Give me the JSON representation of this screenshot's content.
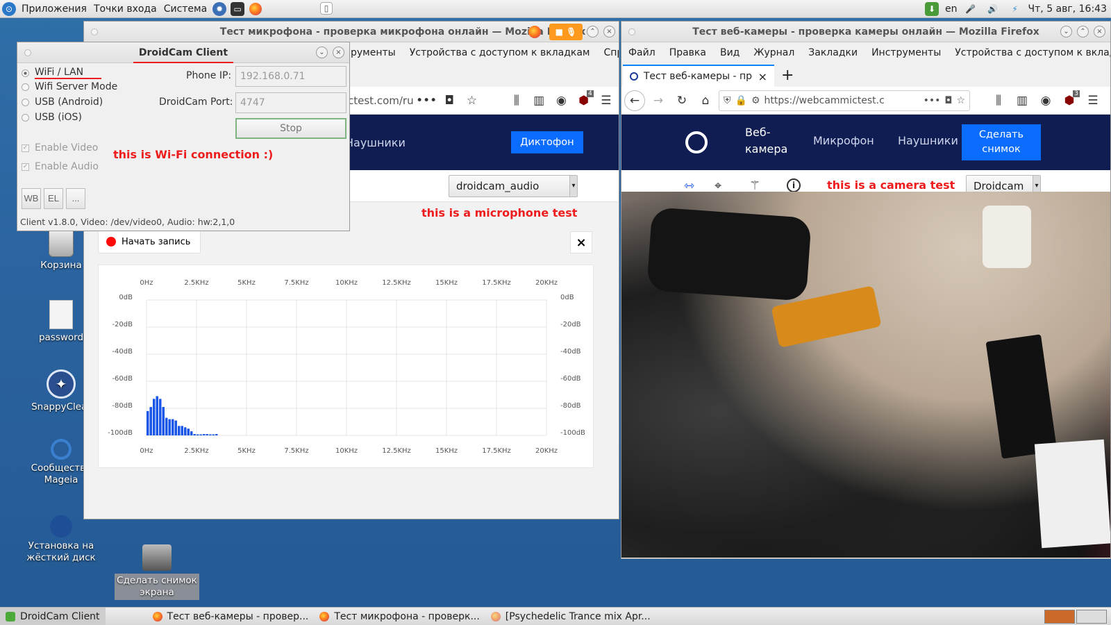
{
  "top_panel": {
    "menus": [
      "Приложения",
      "Точки входа",
      "Система"
    ],
    "lang": "en",
    "clock": "Чт, 5 авг, 16:43"
  },
  "desktop": {
    "icons": [
      {
        "label": "Корзина"
      },
      {
        "label": "password"
      },
      {
        "label": "SnappyClear"
      },
      {
        "label": "Сообщество Mageia"
      },
      {
        "label": "Установка на жёсткий диск"
      },
      {
        "label": "Сделать снимок экрана"
      }
    ]
  },
  "mic_window": {
    "title": "Тест микрофона - проверка микрофона онлайн — Mozilla Firefox",
    "menu_fragment": [
      "рументы",
      "Устройства с доступом к вкладкам",
      "Справ"
    ],
    "url_fragment": "ctest.com/ru/c",
    "nav_items": [
      "Наушники"
    ],
    "dictaphone_button": "Диктофон",
    "device_select": "droidcam_audio",
    "note": "this is a microphone test",
    "record_button": "Начать запись",
    "close_glyph": "×",
    "badge": "4"
  },
  "cam_window": {
    "title": "Тест веб-камеры - проверка камеры онлайн — Mozilla Firefox",
    "menu": [
      "Файл",
      "Правка",
      "Вид",
      "Журнал",
      "Закладки",
      "Инструменты",
      "Устройства с доступом к вкладка"
    ],
    "tab_title": "Тест веб-камеры - пров",
    "url": "https://webcammictest.c",
    "nav": {
      "webcam": "Веб-\nкамера",
      "mic": "Микрофон",
      "headphones": "Наушники",
      "snapshot": "Сделать\nснимок"
    },
    "note": "this is a camera test",
    "device_select": "Droidcam",
    "badge": "3"
  },
  "droidcam": {
    "title": "DroidCam Client",
    "options": [
      "WiFi / LAN",
      "Wifi Server Mode",
      "USB (Android)",
      "USB (iOS)"
    ],
    "selected_option": "WiFi / LAN",
    "phone_ip_label": "Phone IP:",
    "phone_ip": "192.168.0.71",
    "port_label": "DroidCam Port:",
    "port": "4747",
    "stop_button": "Stop",
    "enable_video": "Enable Video",
    "enable_audio": "Enable Audio",
    "note": "this is Wi-Fi connection :)",
    "buttons": [
      "WB",
      "EL",
      "..."
    ],
    "status": "Client v1.8.0, Video: /dev/video0, Audio: hw:2,1,0"
  },
  "taskbar": {
    "tasks": [
      "DroidCam Client",
      "Тест веб-камеры - провер...",
      "Тест микрофона - проверк...",
      "[Psychedelic Trance mix Apr..."
    ]
  },
  "colors": {
    "accent": "#0a6dff",
    "site_nav": "#0f1d52",
    "note_red": "#ee1c1c",
    "bars": "#1a56e8"
  },
  "chart_data": {
    "type": "bar",
    "title": "",
    "x_ticks": [
      "0Hz",
      "2.5KHz",
      "5KHz",
      "7.5KHz",
      "10KHz",
      "12.5KHz",
      "15KHz",
      "17.5KHz",
      "20KHz"
    ],
    "y_ticks": [
      "0dB",
      "-20dB",
      "-40dB",
      "-60dB",
      "-80dB",
      "-100dB"
    ],
    "xlim": [
      0,
      20000
    ],
    "ylim": [
      -100,
      0
    ],
    "grid": true,
    "x": [
      0,
      156,
      312,
      468,
      625,
      781,
      937,
      1093,
      1250,
      1406,
      1562,
      1718,
      1875,
      2031,
      2187,
      2343,
      2500,
      2656,
      2812,
      2968,
      3125,
      3281,
      3437
    ],
    "values": [
      -82,
      -79,
      -73,
      -71,
      -73,
      -79,
      -87,
      -88,
      -88,
      -89,
      -93,
      -93,
      -94,
      -95,
      -97,
      -99,
      -100,
      -100,
      -99,
      -99,
      -100,
      -100,
      -99
    ]
  }
}
